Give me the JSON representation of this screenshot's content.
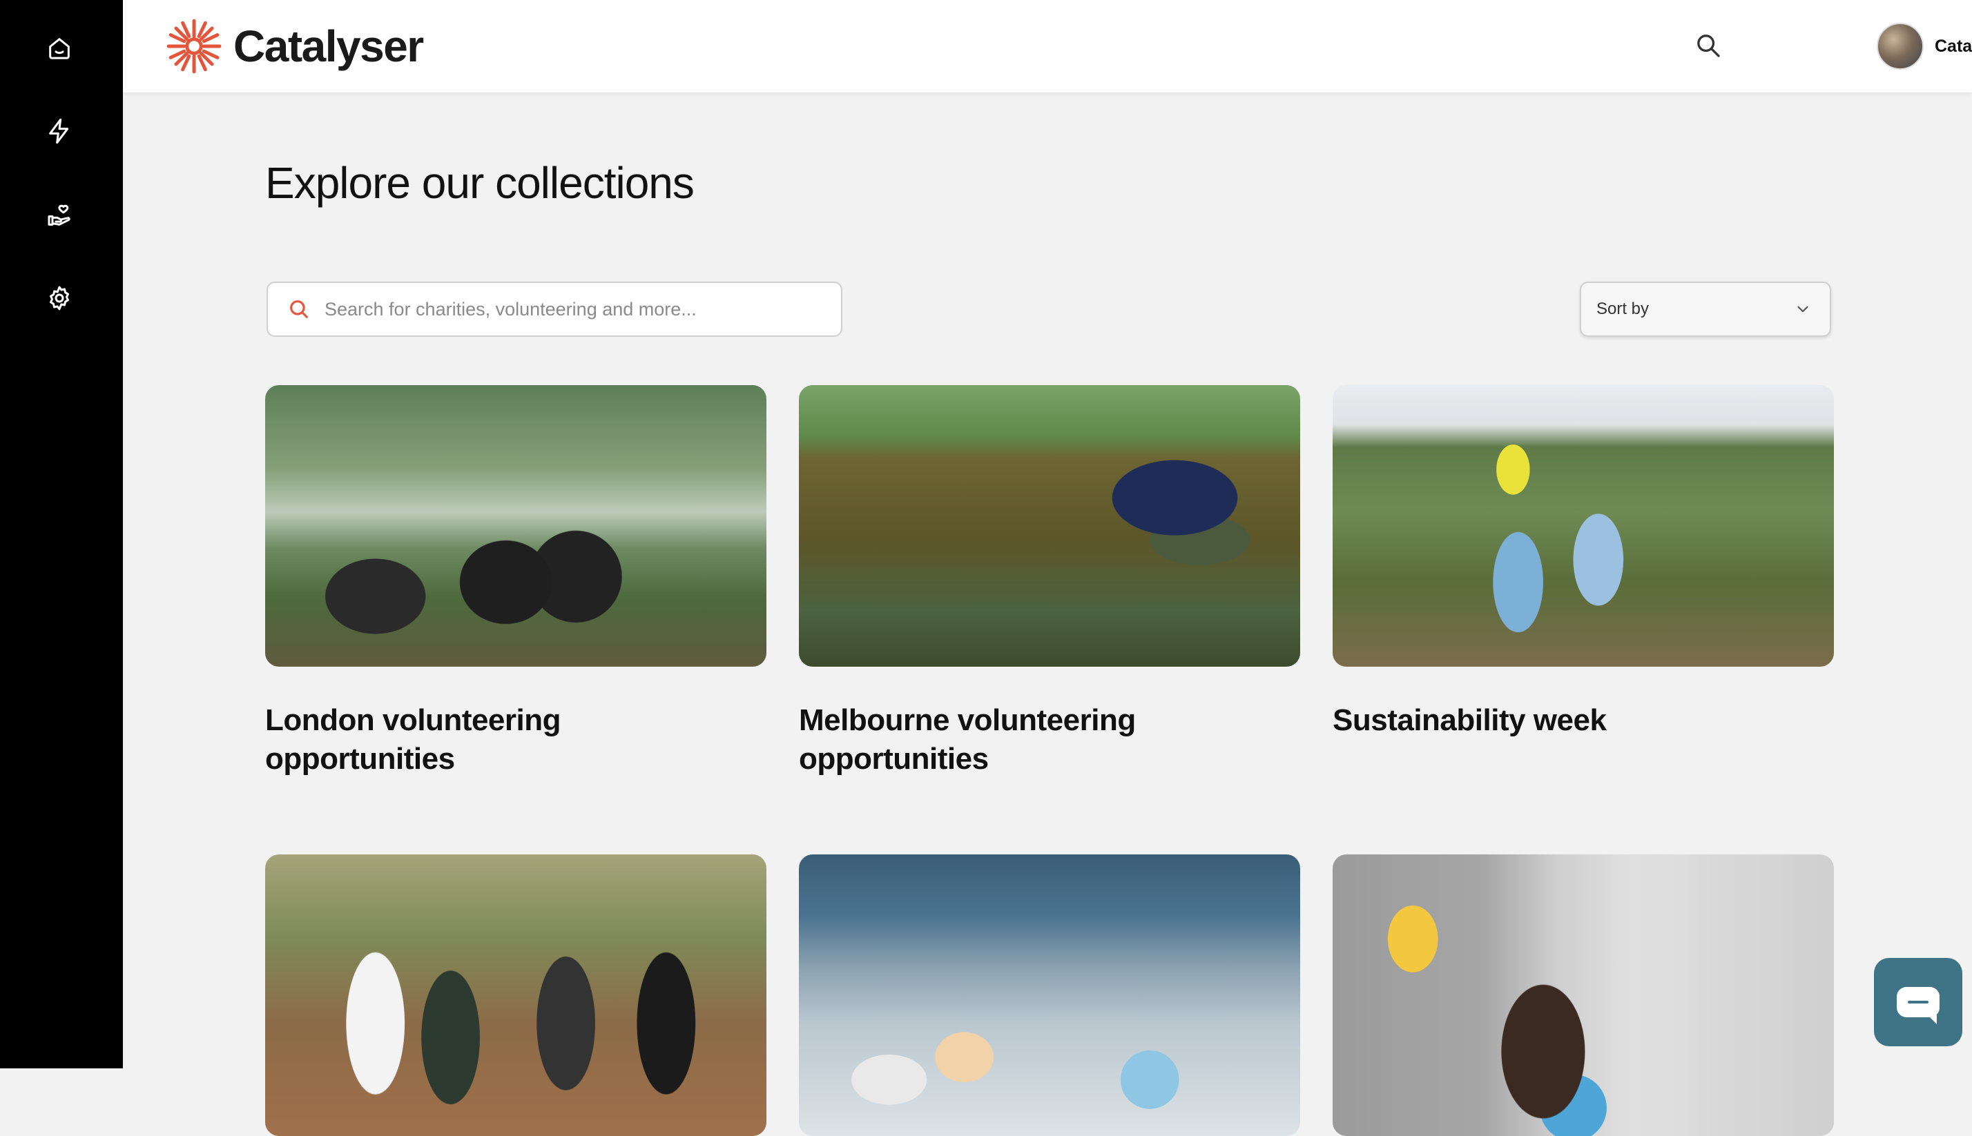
{
  "brand": {
    "name": "Catalyser",
    "accent_color": "#e4553b"
  },
  "nav": {
    "items": [
      {
        "icon": "home-icon"
      },
      {
        "icon": "lightning-icon"
      },
      {
        "icon": "hand-heart-icon"
      },
      {
        "icon": "settings-gear-icon"
      }
    ]
  },
  "header": {
    "search_icon": "search-icon",
    "user": {
      "name": "Catalyser"
    }
  },
  "page": {
    "title": "Explore our collections",
    "search_placeholder": "Search for charities, volunteering and more...",
    "sort_label": "Sort by"
  },
  "collections": [
    {
      "title": "London volunteering opportunities"
    },
    {
      "title": "Melbourne volunteering opportunities"
    },
    {
      "title": "Sustainability week"
    },
    {
      "title": ""
    },
    {
      "title": ""
    },
    {
      "title": ""
    }
  ],
  "chat": {
    "icon": "chat-bubble-icon",
    "color": "#3f7486"
  }
}
